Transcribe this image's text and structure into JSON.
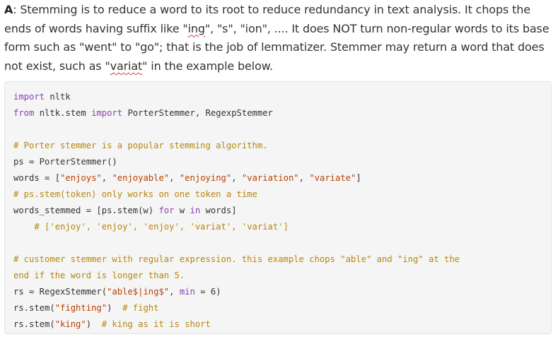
{
  "answer": {
    "prefix": "A",
    "text_1": ": Stemming is to reduce a word to its root to reduce redundancy in text analysis. It chops the ends of words having suffix like \"",
    "ing_word": "ing",
    "text_2": "\", \"s\", \"ion\", .... It does NOT turn non-regular words to its base form such as \"went\" to \"go\"; that is the job of lemmatizer. Stemmer may return a word that does not exist, such as \"",
    "variat_word": "variat",
    "text_3": "\" in the example below."
  },
  "code": {
    "l1_kw": "import",
    "l1_rest": " nltk",
    "l2_kw1": "from",
    "l2_mid": " nltk.stem ",
    "l2_kw2": "import",
    "l2_rest": " PorterStemmer, RegexpStemmer",
    "l4_comment": "# Porter stemmer is a popular stemming algorithm.",
    "l5_text": "ps = PorterStemmer()",
    "l6_pre": "words = [",
    "l6_s1": "\"enjoys\"",
    "l6_s2": "\"enjoyable\"",
    "l6_s3": "\"enjoying\"",
    "l6_s4": "\"variation\"",
    "l6_s5": "\"variate\"",
    "l6_post": "]",
    "l7_comment": "# ps.stem(token) only works on one token a time",
    "l8_pre": "words_stemmed = [ps.stem(w) ",
    "l8_kw1": "for",
    "l8_mid": " w ",
    "l8_kw2": "in",
    "l8_post": " words]",
    "l9_comment": "# ['enjoy', 'enjoy', 'enjoy', 'variat', 'variat']",
    "l11_comment": "# customer stemmer with regular expression. this example chops \"able\" and \"ing\" at the",
    "l12_comment": "end if the word is longer than 5.",
    "l13_pre": "rs = RegexStemmer(",
    "l13_str": "\"able$|ing$\"",
    "l13_mid": ", ",
    "l13_kw": "min",
    "l13_post": " = 6)",
    "l14_pre": "rs.stem(",
    "l14_str": "\"fighting\"",
    "l14_post": ")  ",
    "l14_comment": "# fight",
    "l15_pre": "rs.stem(",
    "l15_str": "\"king\"",
    "l15_post": ")  ",
    "l15_comment": "# king as it is short"
  }
}
